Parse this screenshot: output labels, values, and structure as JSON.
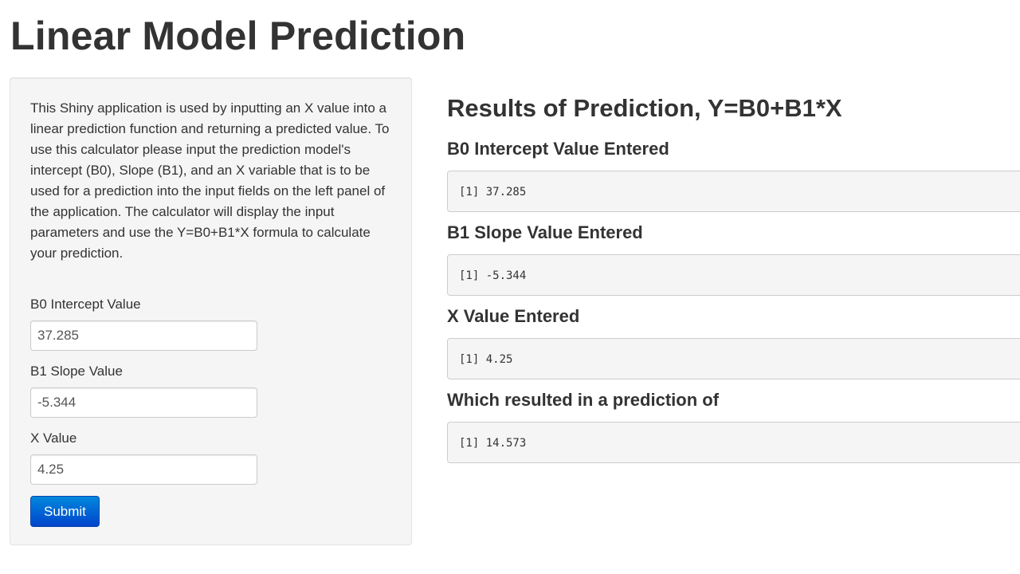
{
  "page": {
    "title": "Linear Model Prediction"
  },
  "sidebar": {
    "description": "This Shiny application is used by inputting an X value into a linear prediction function and returning a predicted value. To use this calculator please input the prediction model's intercept (B0), Slope (B1), and an X variable that is to be used for a prediction into the input fields on the left panel of the application. The calculator will display the input parameters and use the Y=B0+B1*X formula to calculate your prediction.",
    "fields": {
      "b0": {
        "label": "B0 Intercept Value",
        "value": "37.285"
      },
      "b1": {
        "label": "B1 Slope Value",
        "value": "-5.344"
      },
      "x": {
        "label": "X Value",
        "value": "4.25"
      }
    },
    "submit_label": "Submit"
  },
  "results": {
    "title": "Results of Prediction, Y=B0+B1*X",
    "b0": {
      "heading": "B0 Intercept Value Entered",
      "output": "[1] 37.285"
    },
    "b1": {
      "heading": "B1 Slope Value Entered",
      "output": "[1] -5.344"
    },
    "x": {
      "heading": "X Value Entered",
      "output": "[1] 4.25"
    },
    "prediction": {
      "heading": "Which resulted in a prediction of",
      "output": "[1] 14.573"
    }
  },
  "colors": {
    "panel_background": "#f5f5f5",
    "button_primary": "#0055cc",
    "text": "#333333"
  }
}
